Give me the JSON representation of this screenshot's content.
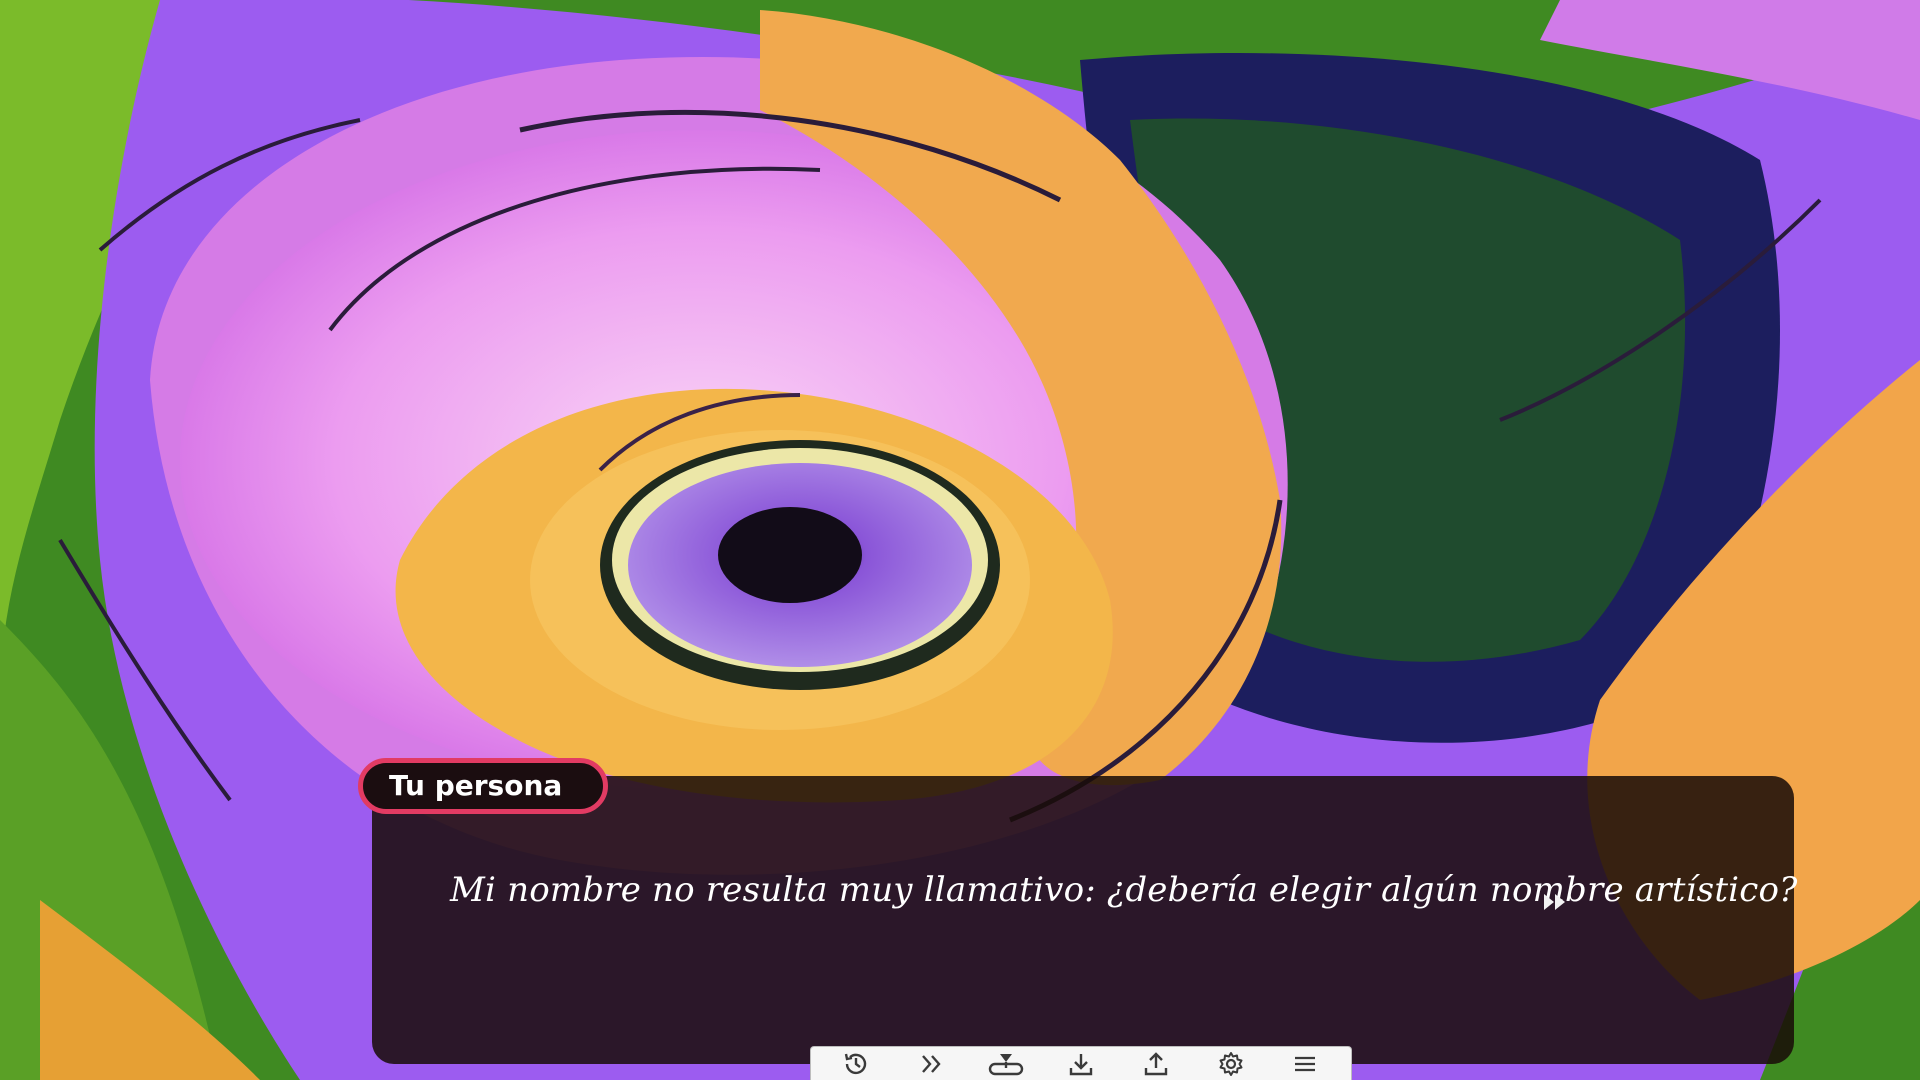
{
  "dialogue": {
    "speaker": "Tu persona",
    "text": "Mi nombre no resulta muy llamativo: ¿debería elegir algún nombre artístico?"
  },
  "quick_menu": {
    "buttons": [
      {
        "id": "history",
        "icon": "history-icon"
      },
      {
        "id": "skip",
        "icon": "skip-icon"
      },
      {
        "id": "auto",
        "icon": "auto-icon"
      },
      {
        "id": "save",
        "icon": "save-icon"
      },
      {
        "id": "load",
        "icon": "load-icon"
      },
      {
        "id": "settings",
        "icon": "gear-icon"
      },
      {
        "id": "menu",
        "icon": "menu-icon"
      }
    ]
  },
  "colors": {
    "speaker_border": "#e23b63",
    "dialogue_bg": "#180c08",
    "menu_bg": "#f6f6f6",
    "menu_icon": "#3a3a3a"
  }
}
